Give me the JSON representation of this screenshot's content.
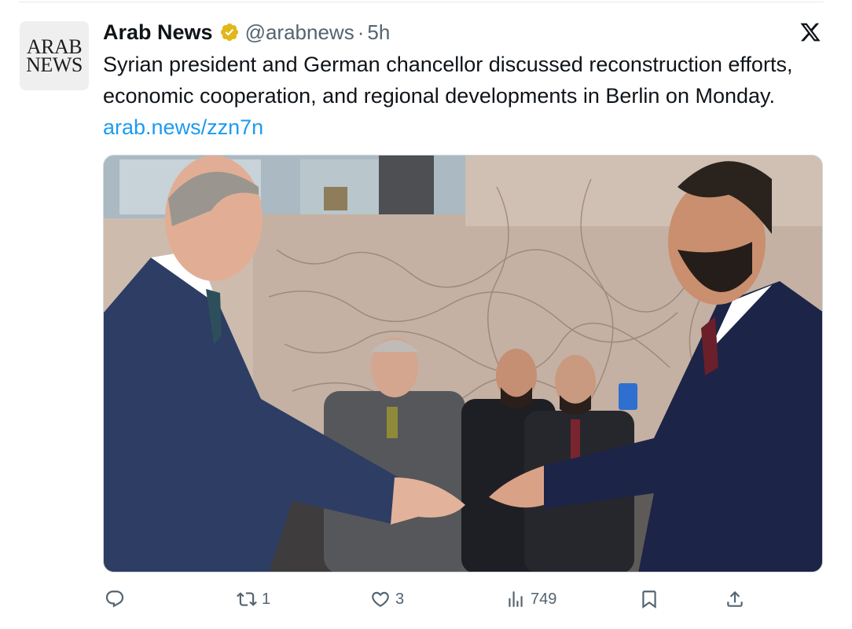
{
  "account": {
    "avatar_text_line1": "ARAB",
    "avatar_text_line2": "NEWS",
    "display_name": "Arab News",
    "handle": "@arabnews",
    "separator": "·",
    "time": "5h",
    "verified_badge_color": "#e2b719"
  },
  "tweet": {
    "text": "Syrian president and German chancellor discussed reconstruction efforts, economic cooperation, and regional developments in Berlin on Monday. ",
    "link": "arab.news/zzn7n"
  },
  "icons": {
    "close": "x-logo-icon",
    "reply": "reply-icon",
    "retweet": "retweet-icon",
    "like": "heart-icon",
    "views": "views-icon",
    "bookmark": "bookmark-icon",
    "share": "share-icon"
  },
  "actions": {
    "reply_count": "",
    "retweet_count": "1",
    "like_count": "3",
    "views_count": "749"
  },
  "colors": {
    "text": "#0f1419",
    "secondary": "#536471",
    "link": "#1d9bf0"
  }
}
